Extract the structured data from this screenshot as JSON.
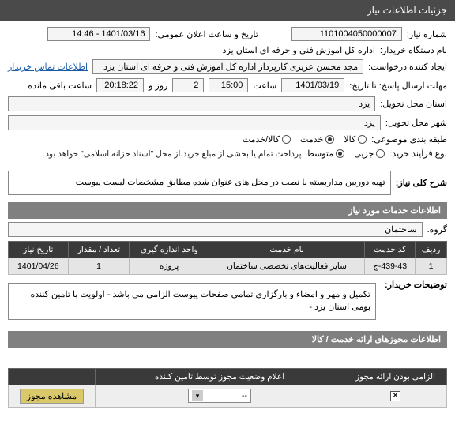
{
  "header": {
    "title": "جزئیات اطلاعات نیاز"
  },
  "fields": {
    "need_no_label": "شماره نیاز:",
    "need_no": "1101004050000007",
    "announce_label": "تاریخ و ساعت اعلان عمومی:",
    "announce": "1401/03/16 - 14:46",
    "buyer_org_label": "نام دستگاه خریدار:",
    "buyer_org": "اداره کل اموزش فنی و حرفه ای استان یزد",
    "requester_label": "ایجاد کننده درخواست:",
    "requester": "مجد محسن عزیزی کارپرداز اداره کل اموزش فنی و حرفه ای استان یزد",
    "contact_link": "اطلاعات تماس خریدار",
    "deadline_label": "مهلت ارسال پاسخ: تا تاریخ:",
    "deadline_date": "1401/03/19",
    "time_label": "ساعت",
    "deadline_time": "15:00",
    "days_value": "2",
    "days_label": "روز و",
    "remain_time": "20:18:22",
    "remain_label": "ساعت باقی مانده",
    "delivery_province_label": "استان محل تحویل:",
    "delivery_province": "یزد",
    "delivery_city_label": "شهر محل تحویل:",
    "delivery_city": "یزد",
    "subject_type_label": "طبقه بندی موضوعی:",
    "radio_kala": "کالا",
    "radio_khadamat": "خدمت",
    "radio_both": "کالا/خدمت",
    "buy_type_label": "نوع فرآیند خرید:",
    "radio_jozi": "جزیی",
    "radio_motevaset": "متوسط",
    "buy_note": "پرداخت تمام یا بخشی از مبلغ خرید،از محل \"اسناد خزانه اسلامی\" خواهد بود."
  },
  "sections": {
    "need_title_label": "شرح کلی نیاز:",
    "need_title": "تهیه دوربین مداربسته با نصب در محل های عنوان شده مطابق مشخصات لیست پیوست",
    "services_header": "اطلاعات خدمات مورد نیاز",
    "group_label": "گروه:",
    "group_value": "ساختمان",
    "buyer_notes_label": "توضیحات خریدار:",
    "buyer_notes": "تکمیل و مهر و امضاء و بارگزاری تمامی صفحات پیوست الزامی می باشد - اولویت با تامین کننده بومی استان یزد -",
    "permits_header": "اطلاعات مجوزهای ارائه خدمت / کالا"
  },
  "table1": {
    "headers": [
      "ردیف",
      "کد خدمت",
      "نام خدمت",
      "واحد اندازه گیری",
      "تعداد / مقدار",
      "تاریخ نیاز"
    ],
    "row": [
      "1",
      "439-43-ج",
      "سایر فعالیت‌های تخصصی ساختمان",
      "پروژه",
      "1",
      "1401/04/26"
    ]
  },
  "table2": {
    "headers": [
      "الزامی بودن ارائه مجوز",
      "اعلام وضعیت مجوز توسط تامین کننده",
      ""
    ],
    "row": {
      "mandatory_checked": true,
      "status": "--",
      "button": "مشاهده مجوز"
    }
  }
}
